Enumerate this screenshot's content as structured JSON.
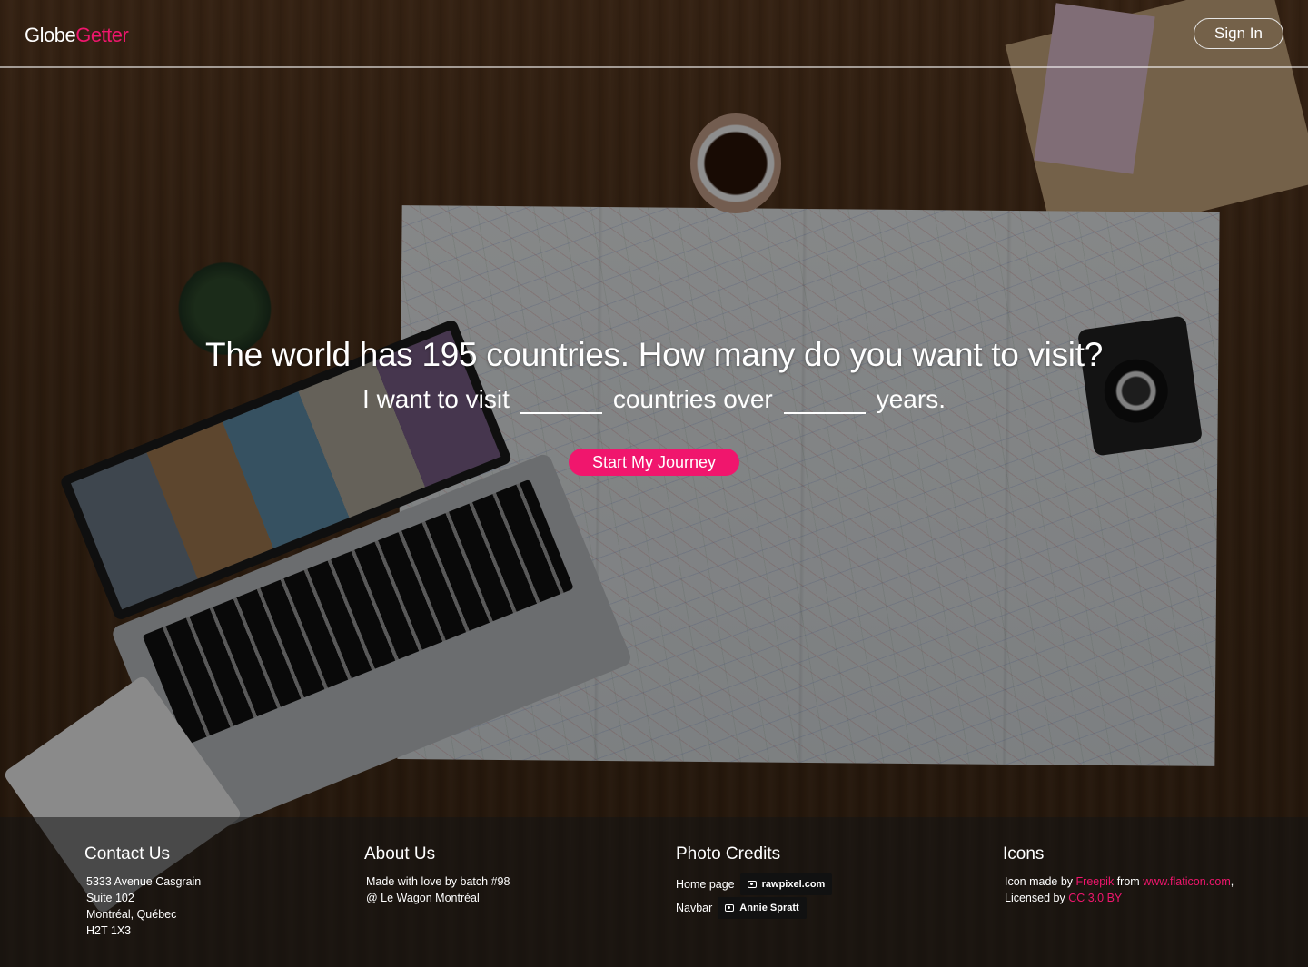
{
  "brand": {
    "first": "Globe",
    "second": "Getter"
  },
  "nav": {
    "signin_label": "Sign In"
  },
  "hero": {
    "headline": "The world has 195 countries. How many do you want to visit?",
    "sentence_part1": "I want to visit",
    "sentence_part2": "countries over",
    "sentence_part3": "years.",
    "countries_value": "",
    "years_value": "",
    "cta_label": "Start My Journey"
  },
  "footer": {
    "contact": {
      "title": "Contact Us",
      "lines": [
        "5333 Avenue Casgrain",
        "Suite 102",
        "Montréal, Québec",
        "H2T 1X3"
      ]
    },
    "about": {
      "title": "About Us",
      "lines": [
        "Made with love by batch #98",
        "@ Le Wagon Montréal"
      ]
    },
    "credits": {
      "title": "Photo Credits",
      "items": [
        {
          "label": "Home page",
          "author": "rawpixel.com"
        },
        {
          "label": "Navbar",
          "author": "Annie Spratt"
        }
      ]
    },
    "icons": {
      "title": "Icons",
      "line1_prefix": "Icon made by",
      "line1_link1": "Freepik",
      "line1_mid": "from",
      "line1_link2": "www.flaticon.com",
      "line1_suffix": ",",
      "line2_prefix": "Licensed by",
      "line2_link": "CC 3.0 BY"
    }
  },
  "colors": {
    "accent": "#f0166d"
  },
  "icons_used": [
    "camera-icon"
  ]
}
